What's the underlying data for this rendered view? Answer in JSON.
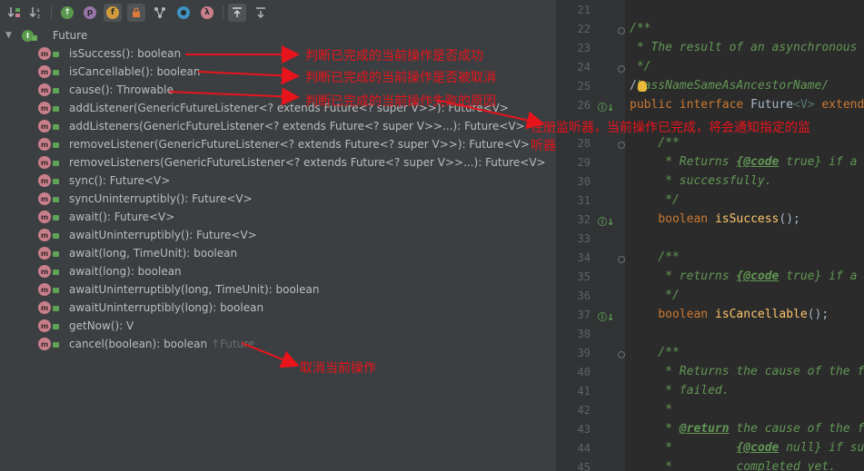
{
  "toolbar": {
    "buttons": [
      {
        "name": "sort-by-visibility-icon",
        "glyph": "↓",
        "sub": "⇅"
      },
      {
        "name": "sort-alphabetically-icon",
        "glyph": "↓",
        "sub": "az"
      },
      {
        "name": "show-inherited-icon",
        "glyph": "I"
      },
      {
        "name": "show-properties-icon",
        "glyph": "p"
      },
      {
        "name": "show-fields-icon",
        "glyph": "f"
      },
      {
        "name": "show-non-public-icon",
        "glyph": "🔒"
      },
      {
        "name": "show-hierarchy-icon",
        "glyph": "Y"
      },
      {
        "name": "show-anonymous-icon",
        "glyph": "○"
      },
      {
        "name": "show-lambdas-icon",
        "glyph": "λ"
      },
      {
        "name": "autoscroll-to-source-icon",
        "glyph": "⤒"
      },
      {
        "name": "autoscroll-from-source-icon",
        "glyph": "⤓"
      }
    ]
  },
  "tree": {
    "root_label": "Future",
    "root_icon": "I",
    "method_icon": "m",
    "methods": [
      {
        "label": "isSuccess(): boolean"
      },
      {
        "label": "isCancellable(): boolean"
      },
      {
        "label": "cause(): Throwable"
      },
      {
        "label": "addListener(GenericFutureListener<? extends Future<? super V>>): Future<V>"
      },
      {
        "label": "addListeners(GenericFutureListener<? extends Future<? super V>>...): Future<V>"
      },
      {
        "label": "removeListener(GenericFutureListener<? extends Future<? super V>>): Future<V>"
      },
      {
        "label": "removeListeners(GenericFutureListener<? extends Future<? super V>>...): Future<V>"
      },
      {
        "label": "sync(): Future<V>"
      },
      {
        "label": "syncUninterruptibly(): Future<V>"
      },
      {
        "label": "await(): Future<V>"
      },
      {
        "label": "awaitUninterruptibly(): Future<V>"
      },
      {
        "label": "await(long, TimeUnit): boolean"
      },
      {
        "label": "await(long): boolean"
      },
      {
        "label": "awaitUninterruptibly(long, TimeUnit): boolean"
      },
      {
        "label": "awaitUninterruptibly(long): boolean"
      },
      {
        "label": "getNow(): V"
      },
      {
        "label": "cancel(boolean): boolean",
        "override": "↑Future"
      }
    ]
  },
  "annotations": {
    "is_success": "判断已完成的当前操作是否成功",
    "is_cancellable": "判断已完成的当前操作是否被取消",
    "cause": "判断已完成的当前操作失败的原因",
    "add_listener_line1": "注册监听器，当前操作已完成，将会通知指定的监",
    "add_listener_line2": "听器",
    "cancel": "取消当前操作"
  },
  "editor": {
    "line_numbers": [
      "21",
      "22",
      "23",
      "24",
      "25",
      "26",
      "",
      "28",
      "29",
      "30",
      "31",
      "32",
      "33",
      "34",
      "35",
      "36",
      "37",
      "38",
      "39",
      "40",
      "41",
      "42",
      "43",
      "44",
      "45"
    ],
    "lines": {
      "l22": "/**",
      "l23": " * The result of an asynchronous",
      "l24": " */",
      "l25_prefix": "/",
      "l25_rest": "LassNameSameAsAncestorName/",
      "l26_kw1": "public",
      "l26_kw2": "interface",
      "l26_name": "Future",
      "l26_gen": "<V>",
      "l26_ext": "extends",
      "l28": "    /**",
      "l29_a": "     * Returns ",
      "l29_tag": "{@code",
      "l29_b": " true} if a",
      "l30": "     * successfully.",
      "l31": "     */",
      "l32_kw": "boolean",
      "l32_fn": "isSuccess",
      "l32_tail": "();",
      "l34": "    /**",
      "l35_a": "     * returns ",
      "l35_tag": "{@code",
      "l35_b": " true} if a",
      "l36": "     */",
      "l37_kw": "boolean",
      "l37_fn": "isCancellable",
      "l37_tail": "();",
      "l39": "    /**",
      "l40": "     * Returns the cause of the f",
      "l41": "     * failed.",
      "l42": "     *",
      "l43_a": "     * ",
      "l43_tag": "@return",
      "l43_b": " the cause of the f",
      "l44_a": "     *         ",
      "l44_tag": "{@code",
      "l44_b": " null} if su",
      "l45": "     *         completed yet."
    }
  },
  "colors": {
    "annotation_red": "#e8141c",
    "panel_bg": "#3c3f41",
    "editor_bg": "#2b2b2b",
    "method_icon": "#c97f8b",
    "interface_icon": "#5a9a4e"
  }
}
